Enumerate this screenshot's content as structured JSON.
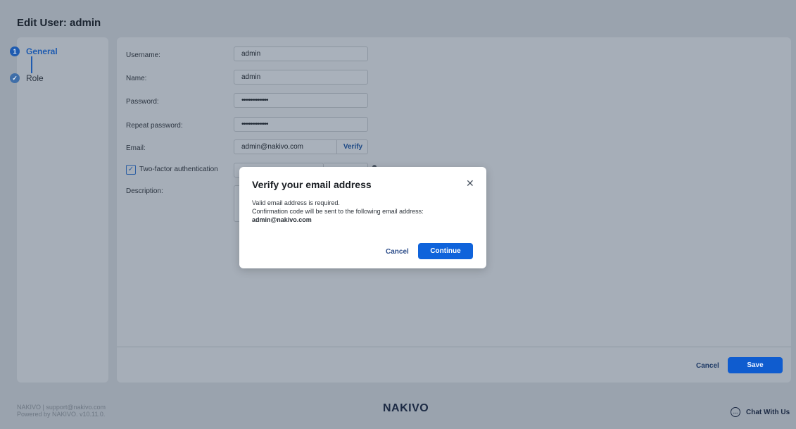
{
  "page": {
    "title": "Edit User: admin"
  },
  "steps": [
    {
      "number": "1",
      "label": "General"
    },
    {
      "number": "✓",
      "label": "Role"
    }
  ],
  "form": {
    "username_label": "Username:",
    "username_value": "admin",
    "name_label": "Name:",
    "name_value": "admin",
    "password_label": "Password:",
    "password_value": "•••••••••••••••",
    "repeat_password_label": "Repeat password:",
    "repeat_password_value": "•••••••••••••••",
    "email_label": "Email:",
    "email_value": "admin@nakivo.com",
    "verify_label": "Verify",
    "two_factor_label": "Two-factor authentication",
    "description_label": "Description:"
  },
  "actions": {
    "cancel": "Cancel",
    "save": "Save"
  },
  "footer": {
    "left_line1": "NAKIVO | support@nakivo.com",
    "left_line2": "Powered by NAKIVO. v10.11.0.",
    "logo": "NAKIVO",
    "chat": "Chat With Us"
  },
  "modal": {
    "title": "Verify your email address",
    "line1": "Valid email address is required.",
    "line2": "Confirmation code will be sent to the following email address:",
    "email": "admin@nakivo.com",
    "cancel": "Cancel",
    "continue": "Continue"
  },
  "colors": {
    "accent": "#0f63db",
    "overlay": "#9aa3ae",
    "modal_background": "#ffffff"
  },
  "icons": [
    "check-icon",
    "close-icon",
    "chat-icon"
  ]
}
